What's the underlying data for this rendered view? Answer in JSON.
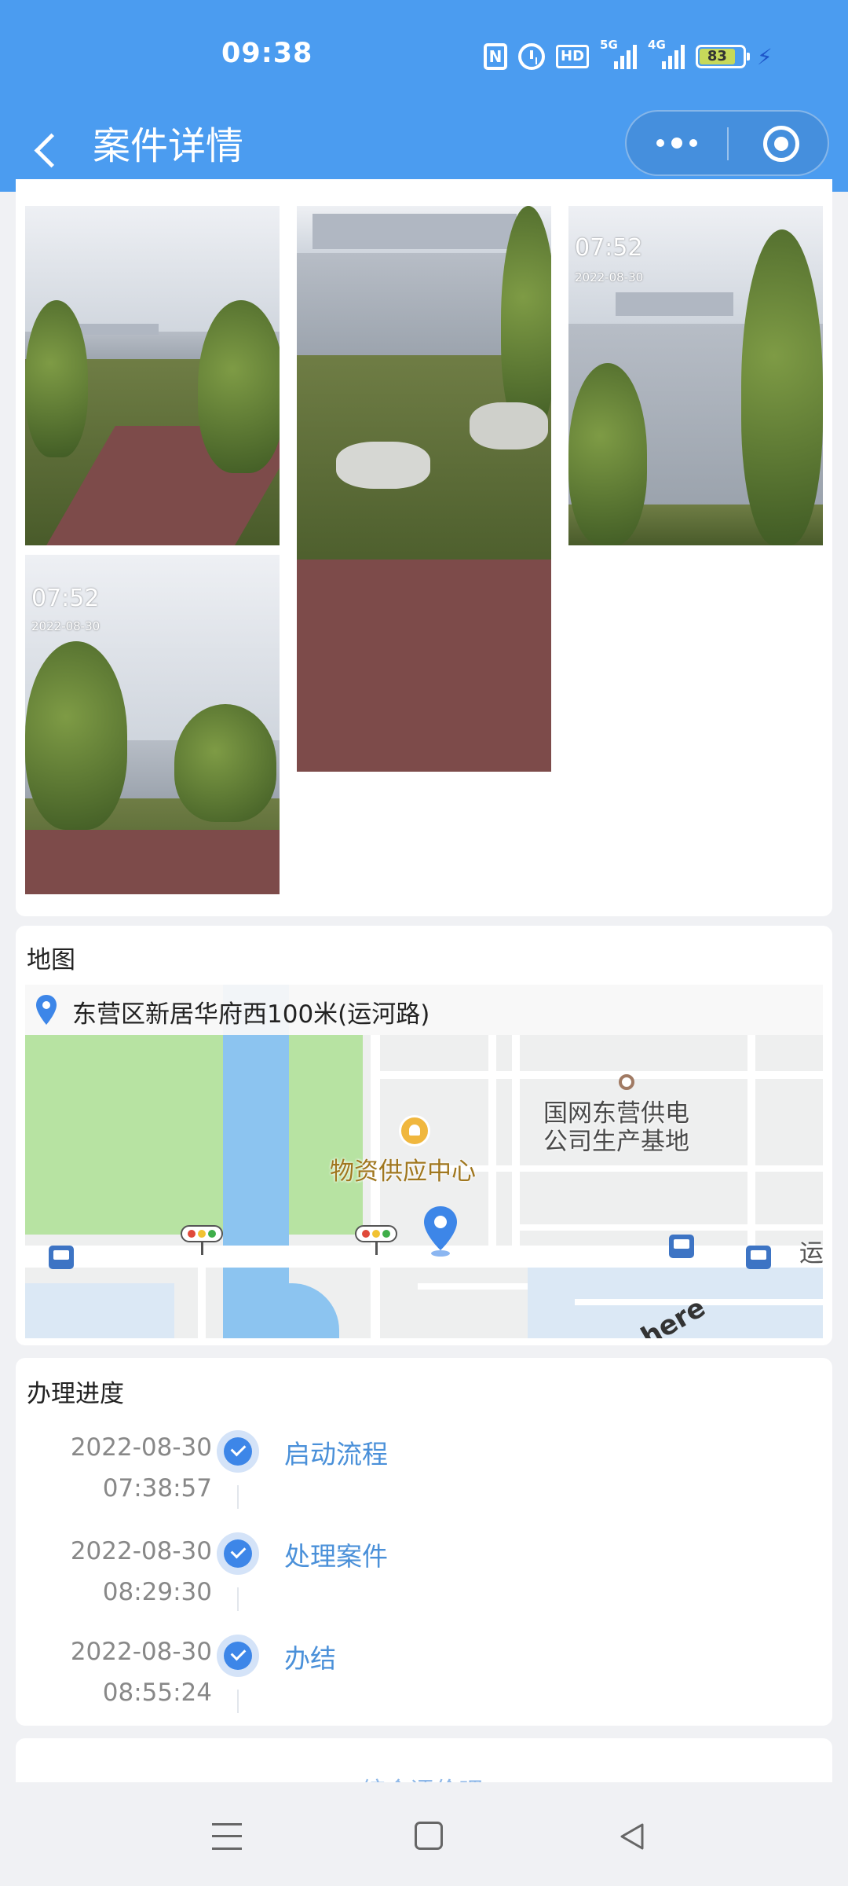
{
  "status_bar": {
    "time": "09:38",
    "nfc_label": "N",
    "hd_label": "HD",
    "signal_1_label": "5G",
    "signal_2_label": "4G",
    "battery_level": "83",
    "icons": [
      "nfc-icon",
      "alarm-icon",
      "hd-icon",
      "signal-5g-icon",
      "signal-4g-icon",
      "battery-icon",
      "charging-icon"
    ]
  },
  "nav": {
    "title": "案件详情",
    "back_icon": "chevron-left-icon",
    "more_icon": "more-dots-icon",
    "close_icon": "target-circle-icon"
  },
  "photos": [
    {
      "stamp_time": "",
      "stamp_date": ""
    },
    {
      "stamp_time": "",
      "stamp_date": ""
    },
    {
      "stamp_time": "07:52",
      "stamp_date": "2022-08-30"
    },
    {
      "stamp_time": "07:52",
      "stamp_date": "2022-08-30"
    }
  ],
  "map_section": {
    "title": "地图",
    "address": "东营区新居华府西100米(运河路)",
    "labels": {
      "poi_1": "物资供应中心",
      "poi_2_line1": "国网东营供电",
      "poi_2_line2": "公司生产基地",
      "road_edge": "运",
      "attribution": "here"
    },
    "colors": {
      "green": "#b7e3a2",
      "water": "#8cc4f0",
      "pin": "#3d86e8",
      "poi": "#f0b73e"
    }
  },
  "progress": {
    "title": "办理进度",
    "steps": [
      {
        "date": "2022-08-30",
        "time": "07:38:57",
        "label": "启动流程"
      },
      {
        "date": "2022-08-30",
        "time": "08:29:30",
        "label": "处理案件"
      },
      {
        "date": "2022-08-30",
        "time": "08:55:24",
        "label": "办结"
      }
    ]
  },
  "bottom": {
    "partial_text": "综合评价吧"
  },
  "system_nav": {
    "menu_icon": "menu-lines-icon",
    "home_icon": "home-square-icon",
    "back_icon": "back-triangle-icon"
  }
}
